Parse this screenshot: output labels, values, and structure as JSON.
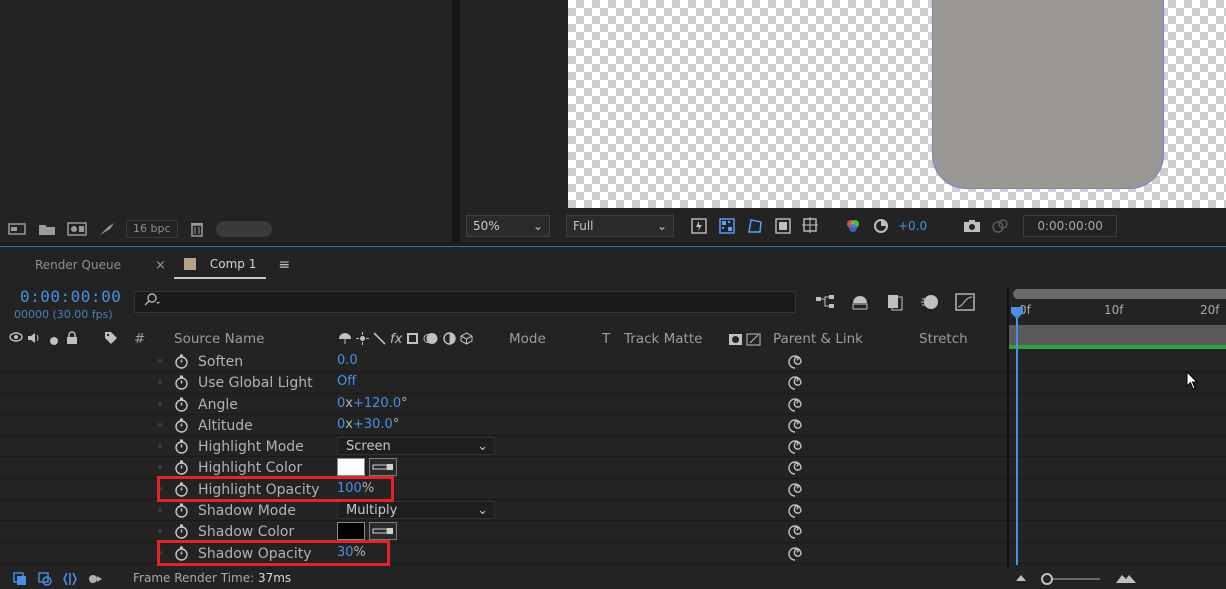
{
  "project_panel": {
    "bit_depth": "16 bpc"
  },
  "viewer": {
    "zoom": "50%",
    "resolution": "Full",
    "exposure": "+0.0",
    "timecode": "0:00:00:00"
  },
  "tabs": [
    {
      "label": "Render Queue"
    },
    {
      "label": "Comp 1"
    }
  ],
  "timeline": {
    "current_time": "0:00:00:00",
    "frames_fps": "00000 (30.00 fps)",
    "search_placeholder": "",
    "headers": {
      "source_name": "Source Name",
      "number": "#",
      "mode": "Mode",
      "t": "T",
      "track_matte": "Track Matte",
      "parent_link": "Parent & Link",
      "stretch": "Stretch"
    },
    "ruler": {
      "labels": [
        "0f",
        "10f",
        "20f"
      ]
    },
    "properties": [
      {
        "name": "Soften",
        "value": "0.0",
        "kind": "value"
      },
      {
        "name": "Use Global Light",
        "value": "Off",
        "kind": "value"
      },
      {
        "name": "Angle",
        "value": "0",
        "unit": "x",
        "value2": "+120.0",
        "unit2": "°",
        "kind": "angle"
      },
      {
        "name": "Altitude",
        "value": "0",
        "unit": "x",
        "value2": "+30.0",
        "unit2": "°",
        "kind": "angle"
      },
      {
        "name": "Highlight Mode",
        "value": "Screen",
        "kind": "dropdown"
      },
      {
        "name": "Highlight Color",
        "value": "#ffffff",
        "kind": "color"
      },
      {
        "name": "Highlight Opacity",
        "value": "100",
        "unit": "%",
        "kind": "percent",
        "highlighted": true
      },
      {
        "name": "Shadow Mode",
        "value": "Multiply",
        "kind": "dropdown"
      },
      {
        "name": "Shadow Color",
        "value": "#000000",
        "kind": "color"
      },
      {
        "name": "Shadow Opacity",
        "value": "30",
        "unit": "%",
        "kind": "percent",
        "highlighted": true
      }
    ]
  },
  "footer": {
    "render_label": "Frame Render Time: ",
    "render_value": "37ms"
  },
  "colors": {
    "accent": "#4a90e2",
    "highlight_box": "#e3232a",
    "work_bar": "#2ea043"
  }
}
